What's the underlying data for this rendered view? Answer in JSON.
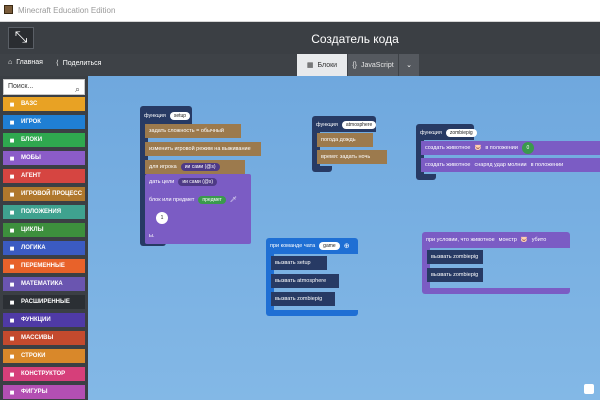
{
  "window": {
    "title": "Minecraft Education Edition"
  },
  "header": {
    "title": "Создатель кода"
  },
  "toolbar": {
    "home_label": "Главная",
    "share_label": "Поделиться",
    "blocks_tab": "Блоки",
    "js_tab": "JavaScript"
  },
  "sidebar": {
    "search_placeholder": "Поиск...",
    "categories": [
      {
        "label": "ВАЗС",
        "color": "#e8a224",
        "icon": "globe-icon"
      },
      {
        "label": "ИГРОК",
        "color": "#1f7fd4",
        "icon": "player-icon"
      },
      {
        "label": "БЛОКИ",
        "color": "#2fa84f",
        "icon": "cube-icon"
      },
      {
        "label": "МОБЫ",
        "color": "#8b5cc8",
        "icon": "mob-icon"
      },
      {
        "label": "АГЕНТ",
        "color": "#d64541",
        "icon": "agent-icon"
      },
      {
        "label": "ИГРОВОЙ ПРОЦЕСС",
        "color": "#b0782d",
        "icon": "wrench-icon"
      },
      {
        "label": "ПОЛОЖЕНИЯ",
        "color": "#3fa28f",
        "icon": "position-icon"
      },
      {
        "label": "ЦИКЛЫ",
        "color": "#3d8f3d",
        "icon": "loop-icon"
      },
      {
        "label": "ЛОГИКА",
        "color": "#3b5bc2",
        "icon": "logic-icon"
      },
      {
        "label": "ПЕРЕМЕННЫЕ",
        "color": "#e8622a",
        "icon": "var-icon"
      },
      {
        "label": "МАТЕМАТИКА",
        "color": "#6a55b0",
        "icon": "math-icon"
      },
      {
        "label": "РАСШИРЕННЫЕ",
        "color": "#2b2f34",
        "icon": "chevron-up-icon"
      },
      {
        "label": "ФУНКЦИИ",
        "color": "#4f3aa6",
        "icon": "function-icon"
      },
      {
        "label": "МАССИВЫ",
        "color": "#c44a2e",
        "icon": "array-icon"
      },
      {
        "label": "СТРОКИ",
        "color": "#d9882a",
        "icon": "text-icon"
      },
      {
        "label": "КОНСТРУКТОР",
        "color": "#d63f7a",
        "icon": "builder-icon"
      },
      {
        "label": "ФИГУРЫ",
        "color": "#b34fb3",
        "icon": "shape-icon"
      }
    ]
  },
  "blocks": {
    "setup": {
      "func_label": "функция",
      "name": "setup",
      "difficulty_label": "задать сложность = обычный",
      "gamemode_label": "изменить игровой режим на выживание",
      "player_label": "для игрока",
      "me_label": "ии сами (@s)",
      "effect_label": "дать цели",
      "effect_me": "ии сами (@s)",
      "item_label": "блок или предмет",
      "item_value": "предмет",
      "count": "1",
      "end": "ы."
    },
    "atmosphere": {
      "func_label": "функция",
      "name": "atmosphere",
      "weather": "погода дождь",
      "time": "время: задать ночь"
    },
    "zombiepig": {
      "func_label": "функция",
      "name": "zombiepig",
      "spawn1": "создать животное",
      "pos1": "в положении",
      "spawn2": "создать животное",
      "near": "снаряд удар молнии",
      "pos2": "в положении",
      "val": "0"
    },
    "chat": {
      "label": "при команде чата",
      "cmd": "game",
      "call1": "вызвать setup",
      "call2": "вызвать atmosphere",
      "call3": "вызвать zombiepig"
    },
    "killed": {
      "label": "при условии, что животное",
      "mob": "монстр",
      "killed": "убито",
      "call1": "вызвать zombiepig",
      "call2": "вызвать zombiepig"
    }
  }
}
